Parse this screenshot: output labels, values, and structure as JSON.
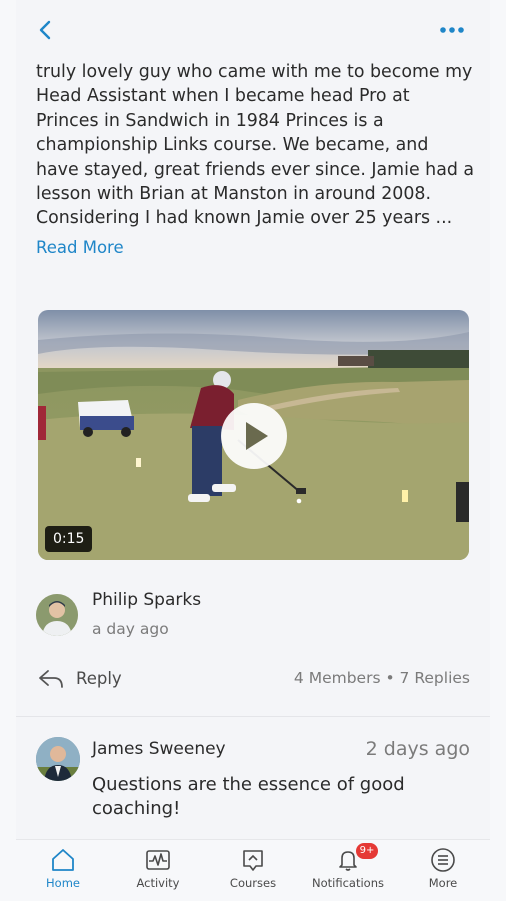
{
  "header": {
    "back_icon": "chevron-left-icon",
    "more_icon": "ellipsis-icon"
  },
  "post": {
    "text": "truly lovely guy who came with me to become my Head Assistant when I became head Pro at Princes in Sandwich in 1984 Princes is a championship Links course. We became, and have stayed, great friends ever since. Jamie had a lesson with Brian at Manston in around 2008. Considering I had known Jamie over 25 years ...",
    "read_more": "Read More",
    "video": {
      "duration": "0:15",
      "play_icon": "play-icon"
    },
    "author": {
      "name": "Philip Sparks",
      "time": "a day ago"
    },
    "reply_label": "Reply",
    "stats": "4 Members • 7 Replies"
  },
  "reply": {
    "name": "James Sweeney",
    "time": "2 days ago",
    "body": "Questions are the essence of good coaching!"
  },
  "tabs": [
    {
      "label": "Home",
      "icon": "home-icon",
      "active": true
    },
    {
      "label": "Activity",
      "icon": "activity-icon",
      "active": false
    },
    {
      "label": "Courses",
      "icon": "courses-icon",
      "active": false
    },
    {
      "label": "Notifications",
      "icon": "bell-icon",
      "active": false,
      "badge": "9+"
    },
    {
      "label": "More",
      "icon": "more-list-icon",
      "active": false
    }
  ],
  "colors": {
    "accent": "#1f86c8",
    "badge": "#e53935",
    "text": "#2b2b2b",
    "muted": "#7b7b7b"
  }
}
